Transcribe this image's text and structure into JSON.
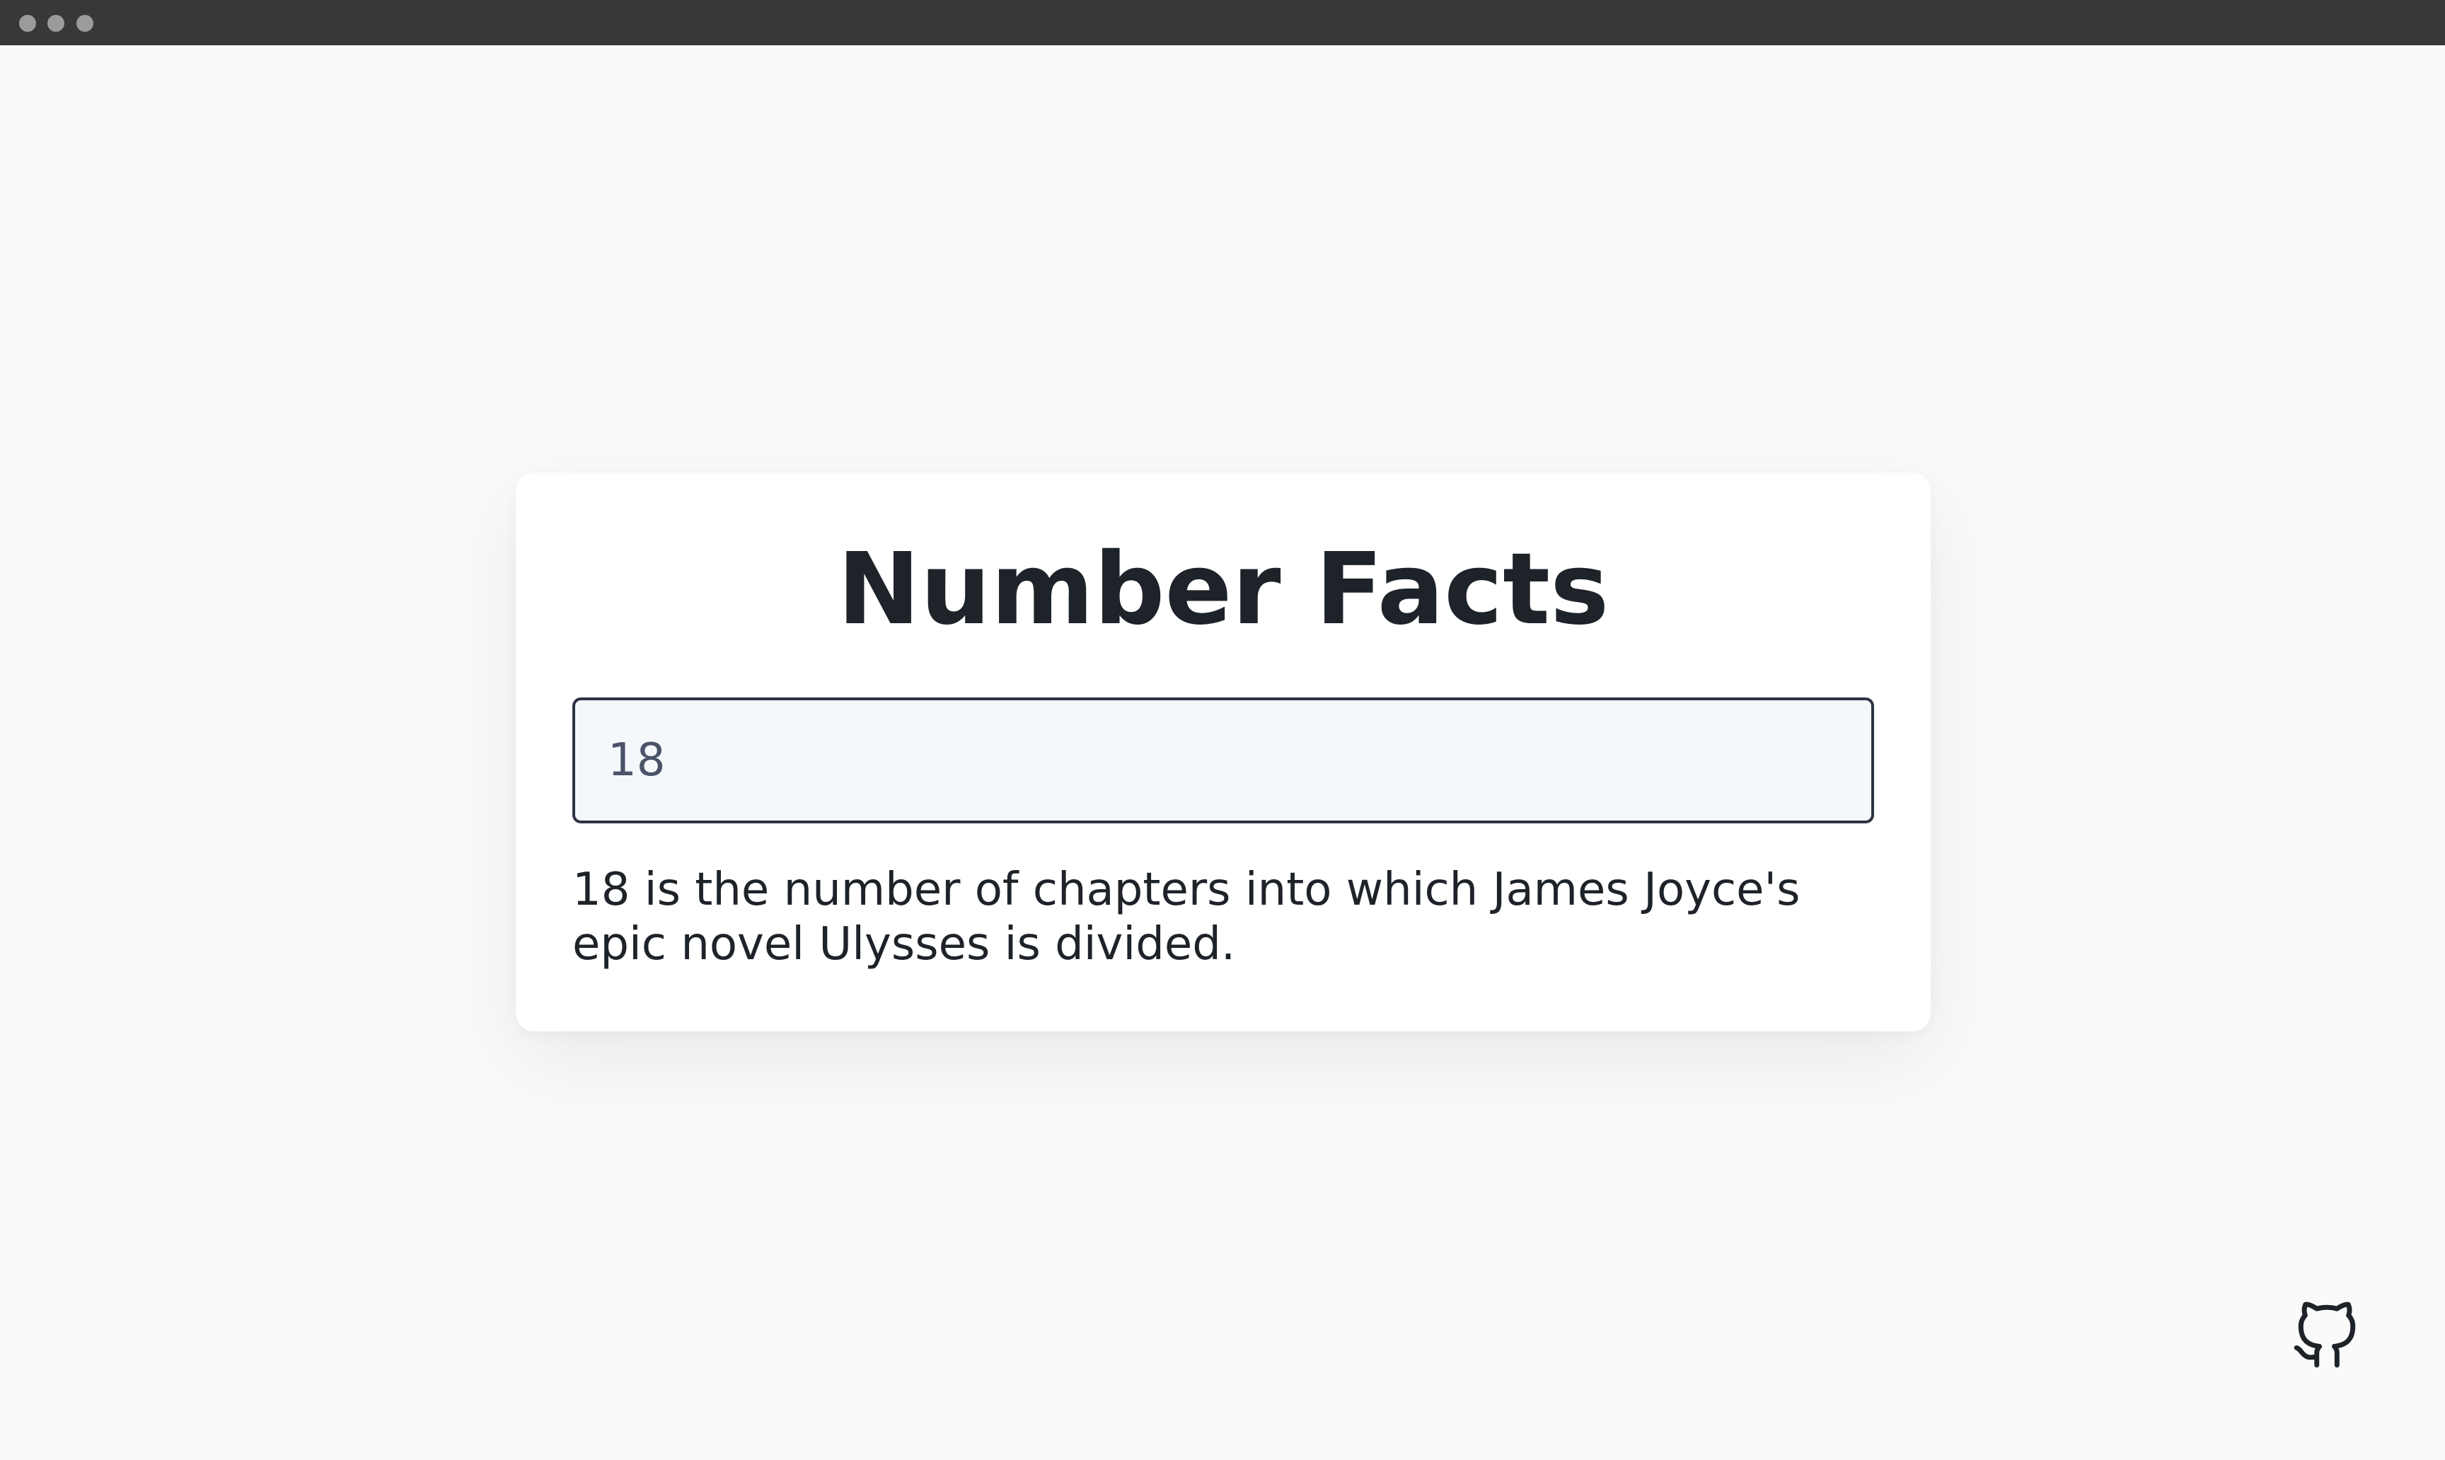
{
  "window": {
    "titlebar_buttons": [
      "close",
      "minimize",
      "maximize"
    ]
  },
  "card": {
    "title": "Number Facts",
    "input": {
      "value": "18",
      "placeholder": ""
    },
    "fact_text": "18 is the number of chapters into which James Joyce's epic novel Ulysses is divided."
  },
  "footer": {
    "icon": "github-icon"
  },
  "colors": {
    "background": "#fafafa",
    "card": "#ffffff",
    "text": "#1e2329",
    "input_border": "#2c3344",
    "input_background": "#f5f8fb",
    "titlebar": "#37383a"
  }
}
